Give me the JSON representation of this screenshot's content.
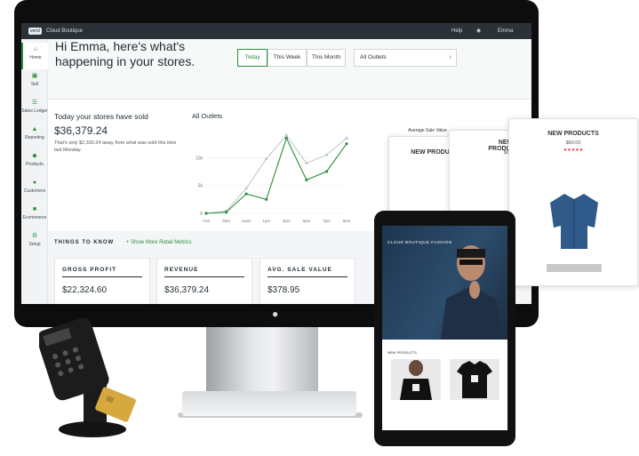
{
  "app": {
    "logo": "vend",
    "store_name": "Cloud Boutique",
    "help": "Help",
    "user": "Emma"
  },
  "sidebar": {
    "items": [
      {
        "label": "Home",
        "icon": "home-icon"
      },
      {
        "label": "Sell",
        "icon": "cart-icon"
      },
      {
        "label": "Sales Ledger",
        "icon": "ledger-icon"
      },
      {
        "label": "Reporting",
        "icon": "chart-icon"
      },
      {
        "label": "Products",
        "icon": "tag-icon"
      },
      {
        "label": "Customers",
        "icon": "people-icon"
      },
      {
        "label": "Ecommerce",
        "icon": "ecommerce-icon"
      },
      {
        "label": "Setup",
        "icon": "gear-icon"
      }
    ]
  },
  "hero": {
    "greeting": "Hi Emma, here's what's happening in your stores.",
    "tabs": [
      "Today",
      "This Week",
      "This Month"
    ],
    "outlet_select": "All Outlets"
  },
  "summary": {
    "label": "Today your stores have sold",
    "amount": "$36,379.24",
    "note": "That's only $2,330.24 away from what was sold this time last Monday."
  },
  "chart_title": "All Outlets",
  "chart_data": {
    "type": "line",
    "title": "All Outlets",
    "categories": [
      "7am",
      "9am",
      "11am",
      "1pm",
      "3pm",
      "5pm",
      "7pm",
      "9pm"
    ],
    "ytick_labels": [
      "0",
      "5k",
      "10k"
    ],
    "ylim": [
      0,
      15000
    ],
    "series": [
      {
        "values": [
          0,
          200,
          3500,
          2500,
          13500,
          6000,
          7500,
          12500
        ],
        "color": "#2e8f3e"
      },
      {
        "values": [
          0,
          400,
          4500,
          9800,
          14000,
          9000,
          10500,
          13500
        ],
        "color": "#c4c9cd"
      }
    ]
  },
  "things": {
    "title": "THINGS TO KNOW",
    "show_more": "Show More Retail Metrics",
    "cards": [
      {
        "title": "GROSS PROFIT",
        "value": "$22,324.60"
      },
      {
        "title": "REVENUE",
        "value": "$36,379.24"
      },
      {
        "title": "AVG. SALE VALUE",
        "value": "$378.95"
      }
    ]
  },
  "popups": {
    "avg_label": "Average Sale Value",
    "title": "NEW PRODUCTS",
    "price": "$60.00"
  },
  "tablet": {
    "brand": "CLOUD BOUTIQUE FASHION",
    "section": "NEW PRODUCTS"
  },
  "colors": {
    "accent": "#2e8f3e",
    "topbar": "#2b3138"
  }
}
